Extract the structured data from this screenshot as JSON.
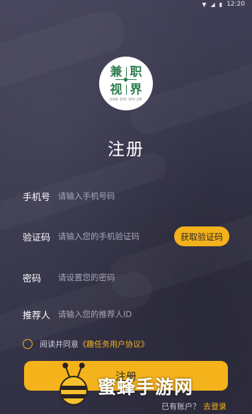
{
  "status_bar": {
    "time": "12:20",
    "icons": [
      "wifi-icon",
      "signal-icon",
      "battery-icon"
    ]
  },
  "logo": {
    "row1": [
      "兼",
      "职"
    ],
    "row2": [
      "视",
      "界"
    ],
    "sub": "JIAN ZHI SHI JIE"
  },
  "title": "注册",
  "fields": {
    "phone": {
      "label": "手机号",
      "placeholder": "请输入手机号码"
    },
    "code": {
      "label": "验证码",
      "placeholder": "请输入您的手机验证码",
      "button": "获取验证码"
    },
    "password": {
      "label": "密码",
      "placeholder": "请设置您的密码"
    },
    "referrer": {
      "label": "推荐人",
      "placeholder": "请输入您的推荐人ID"
    }
  },
  "agreement": {
    "text": "阅读并同意",
    "link": "《趣任务用户协议》"
  },
  "submit_label": "注册",
  "login": {
    "text": "已有账户？",
    "link": "去登录"
  },
  "watermark": "蜜蜂手游网",
  "colors": {
    "accent": "#f4b21b",
    "background": "#3b3a48",
    "logo_green": "#2e7d4f"
  }
}
